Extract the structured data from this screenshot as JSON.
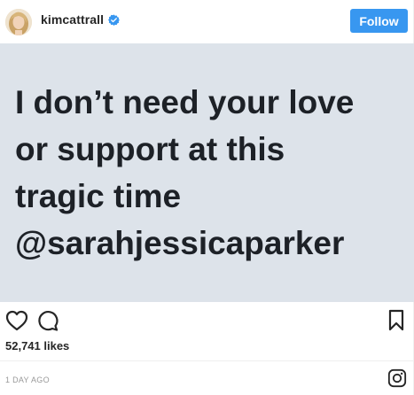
{
  "header": {
    "username": "kimcattrall",
    "follow_label": "Follow",
    "verified": true
  },
  "post": {
    "text_lines": [
      "I don’t need your love",
      "or support at this",
      "tragic time",
      "@sarahjessicaparker"
    ],
    "background_color": "#dde3ea",
    "text_color": "#1d2127"
  },
  "actions": {
    "icons": [
      "heart-icon",
      "comment-icon",
      "bookmark-icon"
    ]
  },
  "likes": "52,741 likes",
  "timestamp": "1 DAY AGO",
  "colors": {
    "accent": "#3897f0",
    "text": "#262626",
    "muted": "#999999"
  }
}
